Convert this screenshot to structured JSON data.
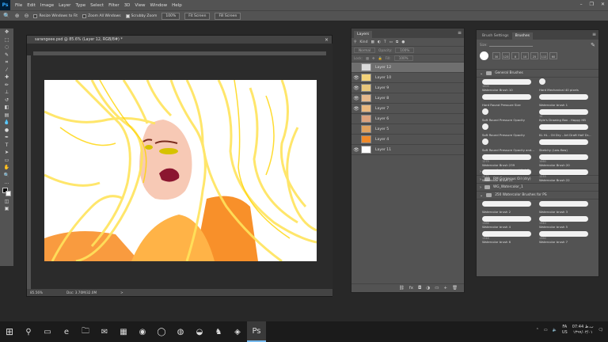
{
  "app": {
    "icon_text": "Ps"
  },
  "menu": [
    "File",
    "Edit",
    "Image",
    "Layer",
    "Type",
    "Select",
    "Filter",
    "3D",
    "View",
    "Window",
    "Help"
  ],
  "window_controls": {
    "minimize": "–",
    "restore": "❐",
    "close": "✕"
  },
  "options": {
    "resize_windows": "Resize Windows to Fit",
    "zoom_all": "Zoom All Windows",
    "scrubby": "Scrubby Zoom",
    "zoom_pct": "100%",
    "fit_screen": "Fit Screen",
    "fill_screen": "Fill Screen"
  },
  "document": {
    "title": "sarangeee.psd @ 85.6% (Layer 12, RGB/8#) *",
    "close": "×",
    "zoom": "85.56%",
    "doc_info": "Doc: 3.70M/32.0M",
    "arrow": ">"
  },
  "layers_panel": {
    "tab": "Layers",
    "menu": "≡",
    "kind_label": "Kind",
    "blend_mode": "Normal",
    "opacity_label": "Opacity:",
    "opacity": "100%",
    "lock_label": "Lock:",
    "fill_label": "Fill:",
    "fill": "100%",
    "layers": [
      {
        "name": "Layer 12",
        "visible": false,
        "selected": true,
        "thumb": "#d9d9d9"
      },
      {
        "name": "Layer 10",
        "visible": true,
        "selected": false,
        "thumb": "#f2d27a"
      },
      {
        "name": "Layer 9",
        "visible": true,
        "selected": false,
        "thumb": "#e8c77c"
      },
      {
        "name": "Layer 8",
        "visible": true,
        "selected": false,
        "thumb": "#e6b98d"
      },
      {
        "name": "Layer 7",
        "visible": true,
        "selected": false,
        "thumb": "#e9b87f"
      },
      {
        "name": "Layer 6",
        "visible": false,
        "selected": false,
        "thumb": "#dca27d"
      },
      {
        "name": "Layer 5",
        "visible": false,
        "selected": false,
        "thumb": "#e0a15e"
      },
      {
        "name": "Layer 4",
        "visible": false,
        "selected": false,
        "thumb": "#f08a2a"
      },
      {
        "name": "Layer 11",
        "visible": true,
        "selected": false,
        "thumb": "#ffffff"
      }
    ],
    "bottom_icons": [
      "fx",
      "◘",
      "◑",
      "▭",
      "+",
      "🗑"
    ]
  },
  "brush_panel": {
    "tab_settings": "Brush Settings",
    "tab_brushes": "Brushes",
    "menu": "≡",
    "size_label": "Size:",
    "preset_numbers": [
      "30",
      "123",
      "8",
      "10",
      "25",
      "112",
      "60"
    ],
    "groups": {
      "general": "General Brushes",
      "grim": "grim_brush_gottlieblin",
      "gorgeous": "RM Gorgeous Oil (dry)",
      "watercolor_1": "WG_Watercolor_1",
      "watercolor_250": "250 Watercolor Brushes for PS"
    },
    "brushes": [
      {
        "num": "1009",
        "name": "Watercolor Brush 10",
        "kind": "stroke"
      },
      {
        "num": "",
        "name": "Hard Mechanical 40 pixels",
        "kind": "dot"
      },
      {
        "num": "",
        "name": "Hard Round Pressure Size",
        "kind": "stroke"
      },
      {
        "num": "",
        "name": "Watercolor brush 1",
        "kind": "stroke"
      },
      {
        "num": "",
        "name": "Soft Round Pressure Opacity",
        "kind": "dot"
      },
      {
        "num": "10",
        "name": "Kyle's Drawing Box - Happy HB",
        "kind": "stroke"
      },
      {
        "num": "",
        "name": "Soft Round Pressure Opacity",
        "kind": "dot"
      },
      {
        "num": "",
        "name": "KL HL - Oil Dry - Art Draft Half Dr...",
        "kind": "stroke"
      },
      {
        "num": "",
        "name": "Soft Round Pressure Opacity and...",
        "kind": "dot"
      },
      {
        "num": "",
        "name": "Sketchy (Low-flow)",
        "kind": "stroke"
      },
      {
        "num": "1275",
        "name": "Watercolor Brush 239",
        "kind": "stroke"
      },
      {
        "num": "1060",
        "name": "Watercolor Brush 20",
        "kind": "stroke"
      },
      {
        "num": "1275",
        "name": "Watercolor Brush 21",
        "kind": "stroke"
      },
      {
        "num": "1233",
        "name": "Watercolor Brush 22",
        "kind": "stroke"
      },
      {
        "num": "",
        "name": "Watercolor brush 2",
        "kind": "stroke"
      },
      {
        "num": "",
        "name": "Watercolor brush 3",
        "kind": "stroke"
      },
      {
        "num": "1386",
        "name": "Watercolor brush 4",
        "kind": "stroke"
      },
      {
        "num": "1340",
        "name": "Watercolor brush 5",
        "kind": "stroke"
      },
      {
        "num": "1348",
        "name": "Watercolor brush 6",
        "kind": "stroke"
      },
      {
        "num": "1360",
        "name": "Watercolor brush 7",
        "kind": "stroke"
      }
    ]
  },
  "taskbar": {
    "icons": [
      "⊞",
      "⚲",
      "▭",
      "e",
      "🗀",
      "✉",
      "▦",
      "◉",
      "◯",
      "◍",
      "◒",
      "♞",
      "◈",
      "Ps"
    ],
    "tray": {
      "lang": "FA",
      "lang2": "US",
      "time": "07:44 ب.ظ",
      "date": "۱۳۹۹/۰۳/۰۱"
    }
  }
}
